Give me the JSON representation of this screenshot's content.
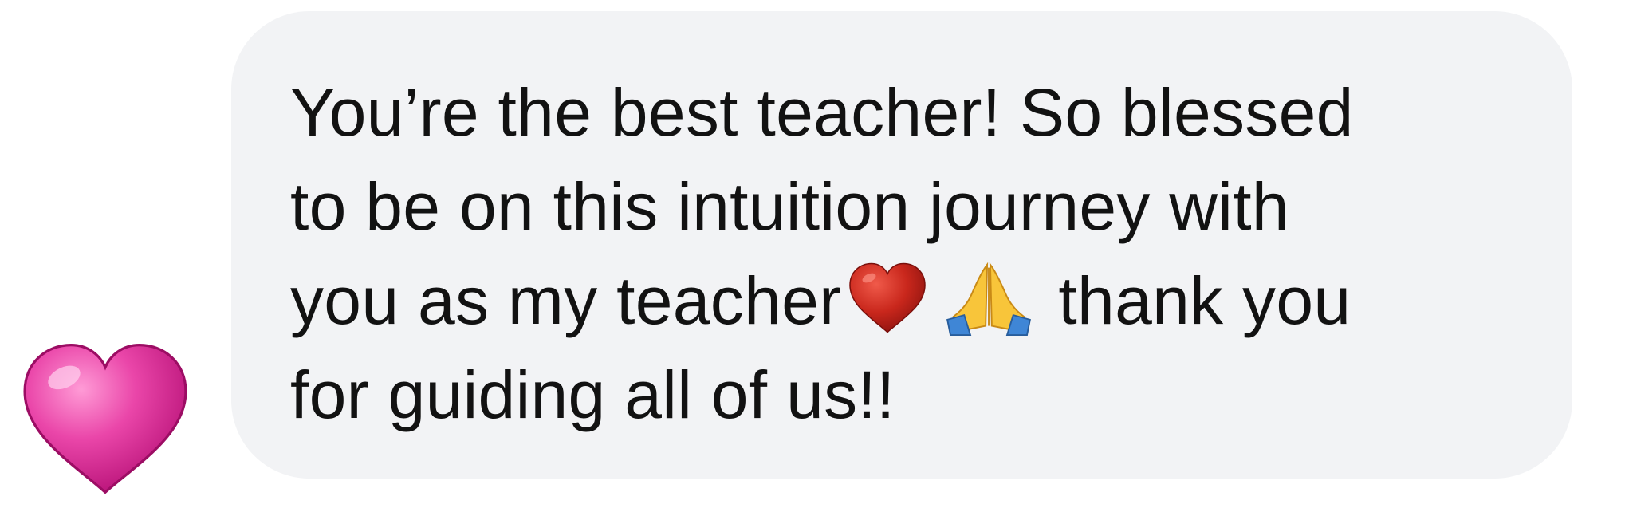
{
  "reaction": {
    "icon": "pink-heart-icon",
    "color": "#e7409f"
  },
  "message": {
    "bubble_color": "#f2f3f5",
    "line1": "You’re the best teacher! So blessed",
    "line2": "to be on this intuition journey with",
    "line3_before": "you as my teacher",
    "line3_after": "thank you",
    "line4": "for guiding all of us!!",
    "emojis": [
      "red-heart-icon",
      "folded-hands-icon"
    ]
  }
}
